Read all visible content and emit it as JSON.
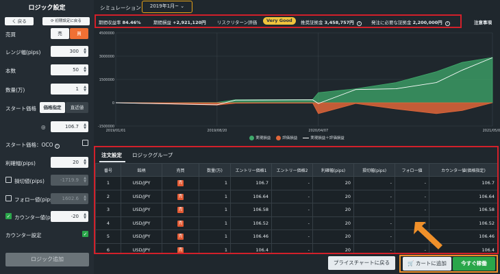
{
  "sidebar": {
    "title": "ロジック設定",
    "back_label": "く 戻る",
    "reset_label": "⟳ 初期設定に戻る",
    "trade_side_label": "売買",
    "sell_label": "売",
    "buy_label": "買",
    "range_label": "レンジ幅(pips)",
    "range_value": "300",
    "count_label": "本数",
    "count_value": "50",
    "quantity_label": "数量(万)",
    "quantity_value": "1",
    "start_price_label": "スタート価格",
    "price_fixed_label": "価格指定",
    "price_recent_label": "直近値",
    "start_price_value": "106.7",
    "oco_label": "スタート価格：OCO",
    "profit_label": "利確幅(pips)",
    "profit_value": "20",
    "stoploss_label": "損切値(pips)",
    "stoploss_value": "-1719.9",
    "follow_label": "フォロー値(pips)",
    "follow_value": "1602.6",
    "counter_label": "カウンター値(pips)",
    "counter_value": "-20",
    "counter_setting_label": "カウンター設定",
    "add_logic_label": "ロジック追加"
  },
  "header": {
    "sim_label": "シミュレーション",
    "period_value": "2019年1月~ ⌄",
    "notes_label": "注意事項"
  },
  "stats": {
    "return_rate_label": "期間収益率",
    "return_rate_value": "84.46%",
    "pnl_label": "期間損益",
    "pnl_value": "+2,921,120円",
    "risk_label": "リスクリターン評価",
    "risk_badge": "Very Good",
    "margin_label": "推奨証拠金",
    "margin_value": "3,458,757円",
    "order_margin_label": "発注に必要な証拠金",
    "order_margin_value": "2,200,000円"
  },
  "chart_data": {
    "type": "area",
    "y_ticks": [
      "4500000",
      "3000000",
      "1500000",
      "0",
      "-1500000"
    ],
    "ylim": [
      -1500000,
      4500000
    ],
    "x_ticks": [
      "2019/01/01",
      "2019/08/20",
      "2020/04/07",
      "2021/05/09"
    ],
    "series": [
      {
        "name": "実現損益",
        "color": "#3fa96b",
        "x": [
          "2019/01/01",
          "2019/05/01",
          "2019/08/20",
          "2019/10/01",
          "2020/01/01",
          "2020/03/25",
          "2020/04/07",
          "2020/07/01",
          "2020/10/01",
          "2021/01/01",
          "2021/03/01",
          "2021/05/09"
        ],
        "values": [
          0,
          0,
          20000,
          200000,
          200000,
          210000,
          650000,
          900000,
          1300000,
          2000000,
          2600000,
          2921120
        ]
      },
      {
        "name": "評価損益",
        "color": "#e0663a",
        "x": [
          "2019/01/01",
          "2019/08/20",
          "2019/10/01",
          "2020/03/25",
          "2020/04/07",
          "2020/07/01",
          "2020/10/01",
          "2021/01/01",
          "2021/03/01",
          "2021/05/09"
        ],
        "values": [
          0,
          -150000,
          -30000,
          -20000,
          -700000,
          -50000,
          -400000,
          -700000,
          -500000,
          0
        ]
      },
      {
        "name": "実現損益＋評価損益",
        "color": "#ffffff",
        "x": [
          "2019/01/01",
          "2019/08/20",
          "2019/10/01",
          "2020/03/25",
          "2020/04/07",
          "2020/07/01",
          "2020/10/01",
          "2021/01/01",
          "2021/03/01",
          "2021/05/09"
        ],
        "values": [
          0,
          -130000,
          170000,
          190000,
          -50000,
          850000,
          900000,
          1300000,
          2100000,
          2900000
        ]
      }
    ],
    "legend_position": "bottom"
  },
  "tabs": [
    {
      "label": "注文設定"
    },
    {
      "label": "ロジックグループ"
    }
  ],
  "table": {
    "headers": [
      "番号",
      "銘柄",
      "売買",
      "数量(万)",
      "エントリー価格1",
      "エントリー価格2",
      "利確幅(pips)",
      "損切幅(pips)",
      "フォロー値",
      "カウンター値(価格指定)"
    ],
    "rows": [
      [
        "1",
        "USD/JPY",
        "売",
        "1",
        "106.7",
        "-",
        "20",
        "-",
        "-",
        "106.7"
      ],
      [
        "2",
        "USD/JPY",
        "売",
        "1",
        "106.64",
        "-",
        "20",
        "-",
        "-",
        "106.64"
      ],
      [
        "3",
        "USD/JPY",
        "売",
        "1",
        "106.58",
        "-",
        "20",
        "-",
        "-",
        "106.58"
      ],
      [
        "4",
        "USD/JPY",
        "売",
        "1",
        "106.52",
        "-",
        "20",
        "-",
        "-",
        "106.52"
      ],
      [
        "5",
        "USD/JPY",
        "売",
        "1",
        "106.46",
        "-",
        "20",
        "-",
        "-",
        "106.46"
      ],
      [
        "6",
        "USD/JPY",
        "売",
        "1",
        "106.4",
        "-",
        "20",
        "-",
        "-",
        "106.4"
      ]
    ]
  },
  "footer": {
    "price_chart_label": "プライスチャートに戻る",
    "cart_label": "カートに追加",
    "buy_now_label": "今すぐ稼働"
  },
  "colors": {
    "accent_buy": "#f07034",
    "realized": "#3fa96b",
    "unrealized": "#e0663a",
    "go_button": "#2aa64a",
    "highlight_red": "#d3202a",
    "highlight_orange": "#f0902a",
    "highlight_yellow": "#e8a317"
  }
}
